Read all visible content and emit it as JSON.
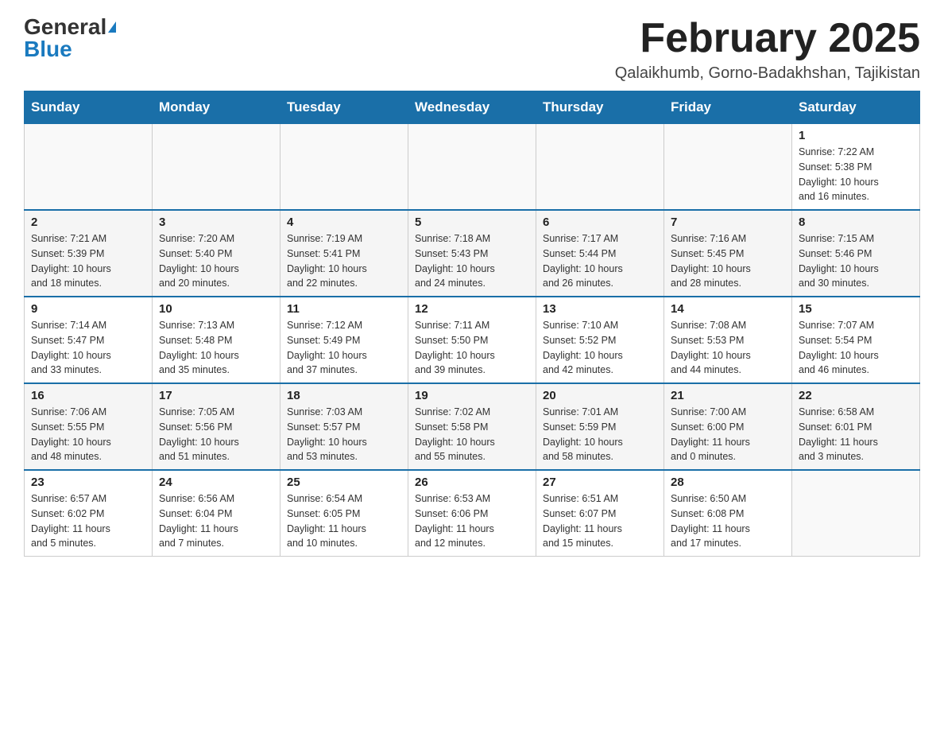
{
  "logo": {
    "general": "General",
    "blue": "Blue"
  },
  "title": {
    "month": "February 2025",
    "location": "Qalaikhumb, Gorno-Badakhshan, Tajikistan"
  },
  "days_of_week": [
    "Sunday",
    "Monday",
    "Tuesday",
    "Wednesday",
    "Thursday",
    "Friday",
    "Saturday"
  ],
  "weeks": [
    [
      {
        "day": "",
        "info": ""
      },
      {
        "day": "",
        "info": ""
      },
      {
        "day": "",
        "info": ""
      },
      {
        "day": "",
        "info": ""
      },
      {
        "day": "",
        "info": ""
      },
      {
        "day": "",
        "info": ""
      },
      {
        "day": "1",
        "info": "Sunrise: 7:22 AM\nSunset: 5:38 PM\nDaylight: 10 hours\nand 16 minutes."
      }
    ],
    [
      {
        "day": "2",
        "info": "Sunrise: 7:21 AM\nSunset: 5:39 PM\nDaylight: 10 hours\nand 18 minutes."
      },
      {
        "day": "3",
        "info": "Sunrise: 7:20 AM\nSunset: 5:40 PM\nDaylight: 10 hours\nand 20 minutes."
      },
      {
        "day": "4",
        "info": "Sunrise: 7:19 AM\nSunset: 5:41 PM\nDaylight: 10 hours\nand 22 minutes."
      },
      {
        "day": "5",
        "info": "Sunrise: 7:18 AM\nSunset: 5:43 PM\nDaylight: 10 hours\nand 24 minutes."
      },
      {
        "day": "6",
        "info": "Sunrise: 7:17 AM\nSunset: 5:44 PM\nDaylight: 10 hours\nand 26 minutes."
      },
      {
        "day": "7",
        "info": "Sunrise: 7:16 AM\nSunset: 5:45 PM\nDaylight: 10 hours\nand 28 minutes."
      },
      {
        "day": "8",
        "info": "Sunrise: 7:15 AM\nSunset: 5:46 PM\nDaylight: 10 hours\nand 30 minutes."
      }
    ],
    [
      {
        "day": "9",
        "info": "Sunrise: 7:14 AM\nSunset: 5:47 PM\nDaylight: 10 hours\nand 33 minutes."
      },
      {
        "day": "10",
        "info": "Sunrise: 7:13 AM\nSunset: 5:48 PM\nDaylight: 10 hours\nand 35 minutes."
      },
      {
        "day": "11",
        "info": "Sunrise: 7:12 AM\nSunset: 5:49 PM\nDaylight: 10 hours\nand 37 minutes."
      },
      {
        "day": "12",
        "info": "Sunrise: 7:11 AM\nSunset: 5:50 PM\nDaylight: 10 hours\nand 39 minutes."
      },
      {
        "day": "13",
        "info": "Sunrise: 7:10 AM\nSunset: 5:52 PM\nDaylight: 10 hours\nand 42 minutes."
      },
      {
        "day": "14",
        "info": "Sunrise: 7:08 AM\nSunset: 5:53 PM\nDaylight: 10 hours\nand 44 minutes."
      },
      {
        "day": "15",
        "info": "Sunrise: 7:07 AM\nSunset: 5:54 PM\nDaylight: 10 hours\nand 46 minutes."
      }
    ],
    [
      {
        "day": "16",
        "info": "Sunrise: 7:06 AM\nSunset: 5:55 PM\nDaylight: 10 hours\nand 48 minutes."
      },
      {
        "day": "17",
        "info": "Sunrise: 7:05 AM\nSunset: 5:56 PM\nDaylight: 10 hours\nand 51 minutes."
      },
      {
        "day": "18",
        "info": "Sunrise: 7:03 AM\nSunset: 5:57 PM\nDaylight: 10 hours\nand 53 minutes."
      },
      {
        "day": "19",
        "info": "Sunrise: 7:02 AM\nSunset: 5:58 PM\nDaylight: 10 hours\nand 55 minutes."
      },
      {
        "day": "20",
        "info": "Sunrise: 7:01 AM\nSunset: 5:59 PM\nDaylight: 10 hours\nand 58 minutes."
      },
      {
        "day": "21",
        "info": "Sunrise: 7:00 AM\nSunset: 6:00 PM\nDaylight: 11 hours\nand 0 minutes."
      },
      {
        "day": "22",
        "info": "Sunrise: 6:58 AM\nSunset: 6:01 PM\nDaylight: 11 hours\nand 3 minutes."
      }
    ],
    [
      {
        "day": "23",
        "info": "Sunrise: 6:57 AM\nSunset: 6:02 PM\nDaylight: 11 hours\nand 5 minutes."
      },
      {
        "day": "24",
        "info": "Sunrise: 6:56 AM\nSunset: 6:04 PM\nDaylight: 11 hours\nand 7 minutes."
      },
      {
        "day": "25",
        "info": "Sunrise: 6:54 AM\nSunset: 6:05 PM\nDaylight: 11 hours\nand 10 minutes."
      },
      {
        "day": "26",
        "info": "Sunrise: 6:53 AM\nSunset: 6:06 PM\nDaylight: 11 hours\nand 12 minutes."
      },
      {
        "day": "27",
        "info": "Sunrise: 6:51 AM\nSunset: 6:07 PM\nDaylight: 11 hours\nand 15 minutes."
      },
      {
        "day": "28",
        "info": "Sunrise: 6:50 AM\nSunset: 6:08 PM\nDaylight: 11 hours\nand 17 minutes."
      },
      {
        "day": "",
        "info": ""
      }
    ]
  ]
}
